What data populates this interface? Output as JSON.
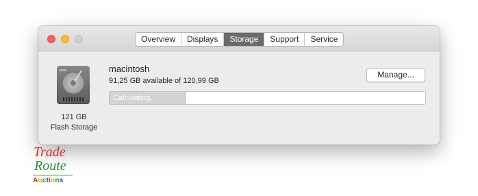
{
  "window": {
    "tabs": [
      {
        "label": "Overview"
      },
      {
        "label": "Displays"
      },
      {
        "label": "Storage"
      },
      {
        "label": "Support"
      },
      {
        "label": "Service"
      }
    ],
    "active_tab": "Storage"
  },
  "disk": {
    "icon": "hard-drive-icon",
    "size": "121 GB",
    "type": "Flash Storage"
  },
  "volume": {
    "name": "macintosh",
    "availability": "91,25 GB available of 120,99 GB",
    "manage_label": "Manage...",
    "bar_label": "Calculating...",
    "bar_fill_fraction": 0.24
  },
  "watermark": {
    "line1": "Trade",
    "line2": "Route",
    "line3": "Auctions",
    "colors": {
      "trade": "#d62828",
      "route": "#2e8b3e",
      "auctions": [
        "#d62828",
        "#f2a900",
        "#2e8b3e",
        "#1f4fb4",
        "#d62828",
        "#f2a900",
        "#2e8b3e",
        "#1f4fb4"
      ]
    }
  },
  "colors": {
    "close": "#fc5f57",
    "minimize": "#fdbc2e",
    "zoom": "#cfcfcf",
    "active_tab": "#6b6b6b",
    "window_bg": "#ececec"
  }
}
